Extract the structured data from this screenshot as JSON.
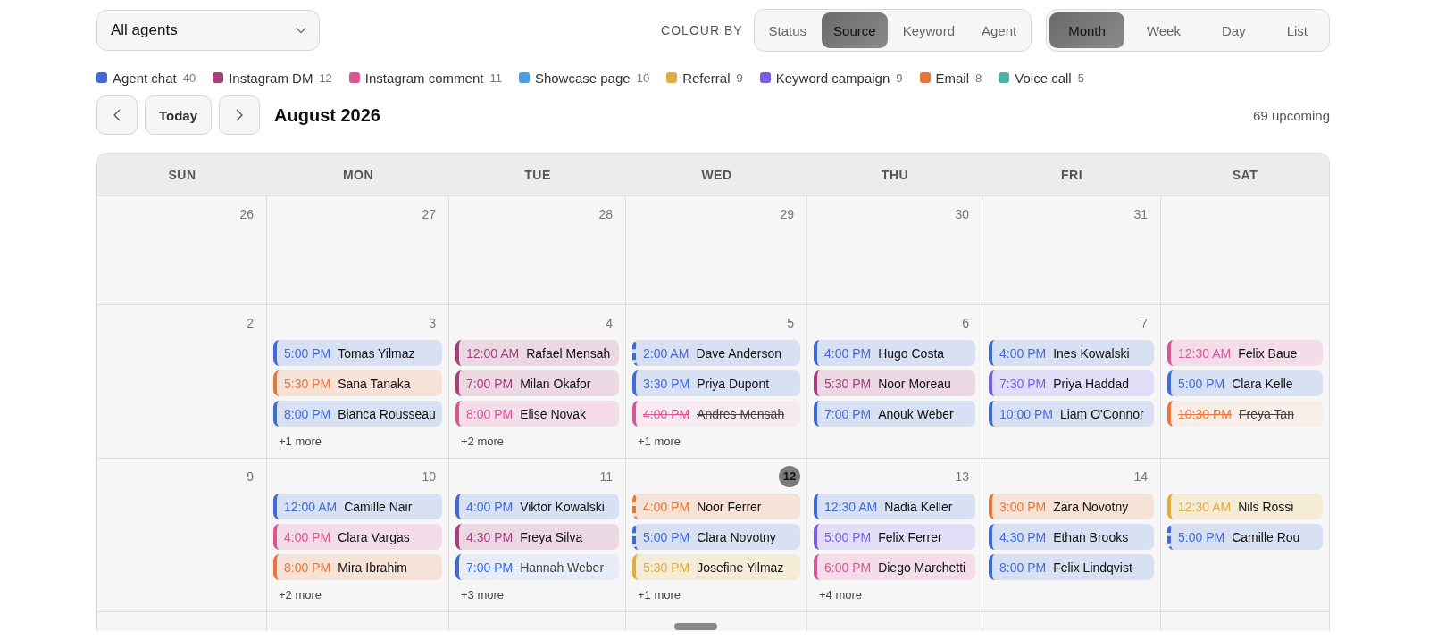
{
  "agent_filter": {
    "value": "All agents"
  },
  "colour_by": {
    "label": "COLOUR BY",
    "options": [
      {
        "label": "Status",
        "selected": false
      },
      {
        "label": "Source",
        "selected": true
      },
      {
        "label": "Keyword",
        "selected": false
      },
      {
        "label": "Agent",
        "selected": false
      }
    ]
  },
  "views": [
    {
      "label": "Month",
      "selected": true
    },
    {
      "label": "Week",
      "selected": false
    },
    {
      "label": "Day",
      "selected": false
    },
    {
      "label": "List",
      "selected": false
    }
  ],
  "legend": [
    {
      "label": "Agent chat",
      "count": "40",
      "color": "#3f6bd8"
    },
    {
      "label": "Instagram DM",
      "count": "12",
      "color": "#a63f7c"
    },
    {
      "label": "Instagram comment",
      "count": "11",
      "color": "#d85596"
    },
    {
      "label": "Showcase page",
      "count": "10",
      "color": "#4a9de0"
    },
    {
      "label": "Referral",
      "count": "9",
      "color": "#e0ad3a"
    },
    {
      "label": "Keyword campaign",
      "count": "9",
      "color": "#7b5ce8"
    },
    {
      "label": "Email",
      "count": "8",
      "color": "#e6773a"
    },
    {
      "label": "Voice call",
      "count": "5",
      "color": "#4fb3a6"
    }
  ],
  "nav": {
    "today": "Today",
    "title": "August 2026",
    "upcoming": "69 upcoming"
  },
  "calendar": {
    "weekdays": [
      "SUN",
      "MON",
      "TUE",
      "WED",
      "THU",
      "FRI",
      "SAT"
    ],
    "weeks": [
      {
        "days": [
          {
            "date": "26",
            "today": false
          },
          {
            "date": "27",
            "today": false
          },
          {
            "date": "28",
            "today": false
          },
          {
            "date": "29",
            "today": false
          },
          {
            "date": "30",
            "today": false
          },
          {
            "date": "31",
            "today": false
          }
        ]
      },
      {
        "days": [
          {
            "date": "2",
            "today": false
          },
          {
            "date": "3",
            "today": false,
            "events": [
              {
                "time": "5:00 PM",
                "name": "Tomas Yilmaz",
                "color": "#3f6bd8",
                "pending": false,
                "cancelled": false
              },
              {
                "time": "5:30 PM",
                "name": "Sana Tanaka",
                "color": "#e6773a",
                "pending": false,
                "cancelled": false
              },
              {
                "time": "8:00 PM",
                "name": "Bianca Rousseau",
                "color": "#3f6bd8",
                "pending": false,
                "cancelled": false
              }
            ],
            "more": "+1 more"
          },
          {
            "date": "4",
            "today": false,
            "events": [
              {
                "time": "12:00 AM",
                "name": "Rafael Mensah",
                "color": "#a63f7c",
                "pending": false,
                "cancelled": false
              },
              {
                "time": "7:00 PM",
                "name": "Milan Okafor",
                "color": "#a63f7c",
                "pending": false,
                "cancelled": false
              },
              {
                "time": "8:00 PM",
                "name": "Elise Novak",
                "color": "#d85596",
                "pending": false,
                "cancelled": false
              }
            ],
            "more": "+2 more"
          },
          {
            "date": "5",
            "today": false,
            "events": [
              {
                "time": "2:00 AM",
                "name": "Dave Anderson",
                "color": "#3f6bd8",
                "pending": true,
                "cancelled": false
              },
              {
                "time": "3:30 PM",
                "name": "Priya Dupont",
                "color": "#3f6bd8",
                "pending": false,
                "cancelled": false
              },
              {
                "time": "4:00 PM",
                "name": "Andres Mensah",
                "color": "#d85596",
                "pending": false,
                "cancelled": true
              }
            ],
            "more": "+1 more"
          },
          {
            "date": "6",
            "today": false,
            "events": [
              {
                "time": "4:00 PM",
                "name": "Hugo Costa",
                "color": "#3f6bd8",
                "pending": false,
                "cancelled": false
              },
              {
                "time": "5:30 PM",
                "name": "Noor Moreau",
                "color": "#a63f7c",
                "pending": false,
                "cancelled": false
              },
              {
                "time": "7:00 PM",
                "name": "Anouk Weber",
                "color": "#3f6bd8",
                "pending": false,
                "cancelled": false
              }
            ]
          },
          {
            "date": "7",
            "today": false,
            "events": [
              {
                "time": "4:00 PM",
                "name": "Ines Kowalski",
                "color": "#3f6bd8",
                "pending": false,
                "cancelled": false
              },
              {
                "time": "7:30 PM",
                "name": "Priya Haddad",
                "color": "#7b5ce8",
                "pending": false,
                "cancelled": false
              },
              {
                "time": "10:00 PM",
                "name": "Liam O'Connor",
                "color": "#3f6bd8",
                "pending": false,
                "cancelled": false
              }
            ]
          },
          {
            "events": [
              {
                "time": "12:30 AM",
                "name": "Felix Baue",
                "color": "#d85596",
                "pending": false,
                "cancelled": false
              },
              {
                "time": "5:00 PM",
                "name": "Clara Kelle",
                "color": "#3f6bd8",
                "pending": false,
                "cancelled": false
              },
              {
                "time": "10:30 PM",
                "name": "Freya Tan",
                "color": "#e6773a",
                "pending": false,
                "cancelled": true
              }
            ]
          }
        ]
      },
      {
        "days": [
          {
            "date": "9",
            "today": false
          },
          {
            "date": "10",
            "today": false,
            "events": [
              {
                "time": "12:00 AM",
                "name": "Camille Nair",
                "color": "#3f6bd8",
                "pending": false,
                "cancelled": false
              },
              {
                "time": "4:00 PM",
                "name": "Clara Vargas",
                "color": "#d85596",
                "pending": false,
                "cancelled": false
              },
              {
                "time": "8:00 PM",
                "name": "Mira Ibrahim",
                "color": "#e6773a",
                "pending": false,
                "cancelled": false
              }
            ],
            "more": "+2 more"
          },
          {
            "date": "11",
            "today": false,
            "events": [
              {
                "time": "4:00 PM",
                "name": "Viktor Kowalski",
                "color": "#3f6bd8",
                "pending": false,
                "cancelled": false
              },
              {
                "time": "4:30 PM",
                "name": "Freya Silva",
                "color": "#a63f7c",
                "pending": false,
                "cancelled": false
              },
              {
                "time": "7:00 PM",
                "name": "Hannah Weber",
                "color": "#3f6bd8",
                "pending": false,
                "cancelled": true
              }
            ],
            "more": "+3 more"
          },
          {
            "date": "12",
            "today": true,
            "events": [
              {
                "time": "4:00 PM",
                "name": "Noor Ferrer",
                "color": "#e6773a",
                "pending": true,
                "cancelled": false
              },
              {
                "time": "5:00 PM",
                "name": "Clara Novotny",
                "color": "#3f6bd8",
                "pending": true,
                "cancelled": false
              },
              {
                "time": "5:30 PM",
                "name": "Josefine Yilmaz",
                "color": "#e0ad3a",
                "pending": false,
                "cancelled": false
              }
            ],
            "more": "+1 more"
          },
          {
            "date": "13",
            "today": false,
            "events": [
              {
                "time": "12:30 AM",
                "name": "Nadia Keller",
                "color": "#3f6bd8",
                "pending": false,
                "cancelled": false
              },
              {
                "time": "5:00 PM",
                "name": "Felix Ferrer",
                "color": "#7b5ce8",
                "pending": false,
                "cancelled": false
              },
              {
                "time": "6:00 PM",
                "name": "Diego Marchetti",
                "color": "#d85596",
                "pending": false,
                "cancelled": false
              }
            ],
            "more": "+4 more"
          },
          {
            "date": "14",
            "today": false,
            "events": [
              {
                "time": "3:00 PM",
                "name": "Zara Novotny",
                "color": "#e6773a",
                "pending": false,
                "cancelled": false
              },
              {
                "time": "4:30 PM",
                "name": "Ethan Brooks",
                "color": "#3f6bd8",
                "pending": false,
                "cancelled": false
              },
              {
                "time": "8:00 PM",
                "name": "Felix Lindqvist",
                "color": "#3f6bd8",
                "pending": false,
                "cancelled": false
              }
            ]
          },
          {
            "events": [
              {
                "time": "12:30 AM",
                "name": "Nils Rossi",
                "color": "#e0ad3a",
                "pending": false,
                "cancelled": false
              },
              {
                "time": "5:00 PM",
                "name": "Camille Rou",
                "color": "#3f6bd8",
                "pending": true,
                "cancelled": false
              }
            ]
          }
        ]
      }
    ]
  }
}
